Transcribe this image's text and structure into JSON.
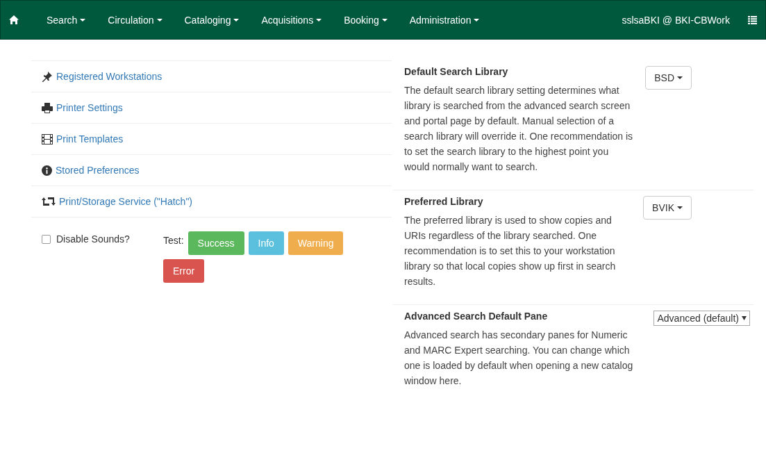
{
  "navbar": {
    "menus": [
      {
        "label": "Search"
      },
      {
        "label": "Circulation"
      },
      {
        "label": "Cataloging"
      },
      {
        "label": "Acquisitions"
      },
      {
        "label": "Booking"
      },
      {
        "label": "Administration"
      }
    ],
    "user": "sslsaBKI @ BKI-CBWork"
  },
  "links": [
    {
      "kind": "pin",
      "label": "Registered Workstations"
    },
    {
      "kind": "printer",
      "label": "Printer Settings"
    },
    {
      "kind": "film",
      "label": "Print Templates"
    },
    {
      "kind": "info",
      "label": "Stored Preferences"
    },
    {
      "kind": "transfer",
      "label": "Print/Storage Service (\"Hatch\")"
    }
  ],
  "sounds": {
    "label": "Disable Sounds?",
    "checked": false,
    "test_label": "Test:",
    "buttons": [
      {
        "kind": "success",
        "label": "Success"
      },
      {
        "kind": "info",
        "label": "Info"
      },
      {
        "kind": "warning",
        "label": "Warning"
      },
      {
        "kind": "danger",
        "label": "Error"
      }
    ]
  },
  "settings": [
    {
      "title": "Default Search Library",
      "description": "The default search library setting determines what library is searched from the advanced search screen and portal page by default. Manual selection of a search library will override it. One recommendation is to set the search library to the highest point you would normally want to search.",
      "kind": "dropdown",
      "value": "BSD"
    },
    {
      "title": "Preferred Library",
      "description": "The preferred library is used to show copies and URIs regardless of the library searched. One recommendation is to set this to your workstation library so that local copies show up first in search results.",
      "kind": "dropdown",
      "value": "BVIK"
    },
    {
      "title": "Advanced Search Default Pane",
      "description": "Advanced search has secondary panes for Numeric and MARC Expert searching. You can change which one is loaded by default when opening a new catalog window here.",
      "kind": "select",
      "value": "Advanced (default)"
    }
  ]
}
